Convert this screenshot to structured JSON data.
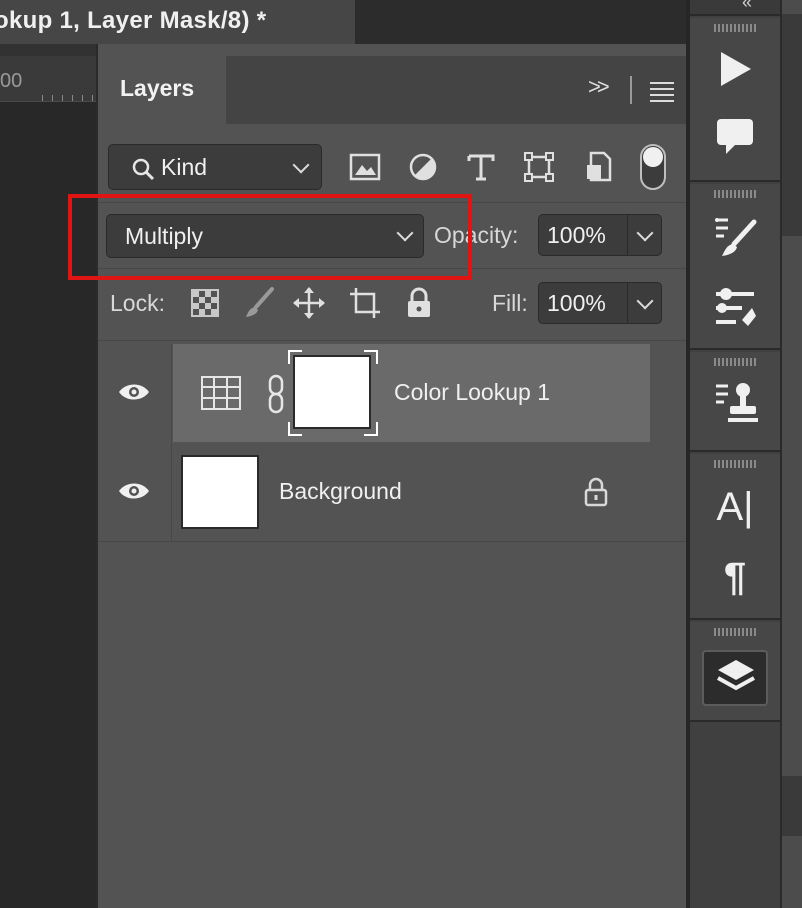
{
  "document": {
    "tab_title": "okup 1, Layer Mask/8) *",
    "ruler_label": "00"
  },
  "panel": {
    "tab_label": "Layers",
    "filter": {
      "kind_label": "Kind",
      "icons": [
        "image-filter-icon",
        "adjustment-filter-icon",
        "type-filter-icon",
        "shape-filter-icon",
        "smart-object-filter-icon",
        "filter-toggle-switch"
      ]
    },
    "blend_mode": "Multiply",
    "opacity_label": "Opacity:",
    "opacity_value": "100%",
    "lock_label": "Lock:",
    "fill_label": "Fill:",
    "fill_value": "100%",
    "layers": [
      {
        "name": "Color Lookup 1",
        "selected": true,
        "visible": true,
        "type": "adjustment",
        "has_mask": true
      },
      {
        "name": "Background",
        "selected": false,
        "visible": true,
        "type": "pixel",
        "locked": true
      }
    ]
  },
  "dock": {
    "tools": [
      "play-icon",
      "comment-icon",
      "brush-presets-icon",
      "adjustments-icon",
      "clone-source-icon",
      "character-icon",
      "paragraph-icon",
      "layers-icon"
    ],
    "character_glyph": "A|",
    "paragraph_glyph": "¶"
  },
  "colors": {
    "panel_bg": "#535353",
    "selected_row": "#6a6a6a",
    "highlight": "#e11414"
  }
}
